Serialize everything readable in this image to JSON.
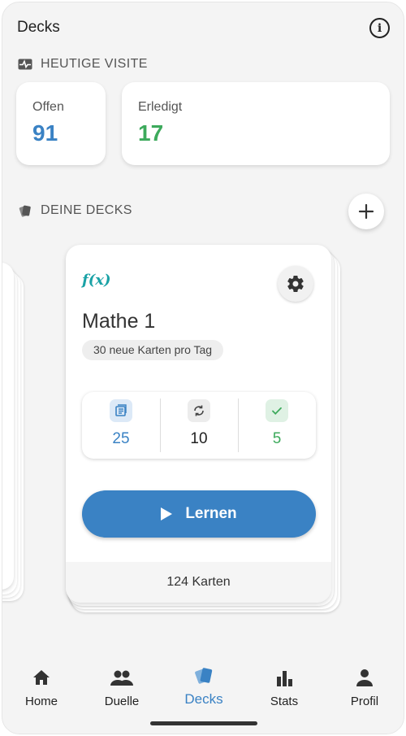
{
  "header": {
    "title": "Decks",
    "info_icon": "info-icon"
  },
  "today": {
    "label": "HEUTIGE VISITE",
    "icon": "pulse-icon",
    "cards": [
      {
        "label": "Offen",
        "value": "91",
        "color": "#3a82c4"
      },
      {
        "label": "Erledigt",
        "value": "17",
        "color": "#3daa5c"
      }
    ]
  },
  "decks_section": {
    "label": "DEINE DECKS",
    "icon": "cards-icon",
    "add_icon": "plus-icon"
  },
  "deck": {
    "icon_text": "f(x)",
    "name": "Mathe 1",
    "new_per_day": "30 neue Karten pro Tag",
    "settings_icon": "gear-icon",
    "counts": [
      {
        "icon": "list-icon",
        "value": "25",
        "color": "#3a82c4",
        "badge_bg": "#dce9f7"
      },
      {
        "icon": "repeat-icon",
        "value": "10",
        "color": "#222222",
        "badge_bg": "#ececec"
      },
      {
        "icon": "check-icon",
        "value": "5",
        "color": "#3daa5c",
        "badge_bg": "#dff1e4"
      }
    ],
    "learn_label": "Lernen",
    "total": "124 Karten"
  },
  "nav": {
    "items": [
      {
        "label": "Home",
        "icon": "home-icon"
      },
      {
        "label": "Duelle",
        "icon": "people-icon"
      },
      {
        "label": "Decks",
        "icon": "cards-icon",
        "active": true
      },
      {
        "label": "Stats",
        "icon": "bar-chart-icon"
      },
      {
        "label": "Profil",
        "icon": "person-icon"
      }
    ],
    "active_color": "#3a82c4"
  }
}
